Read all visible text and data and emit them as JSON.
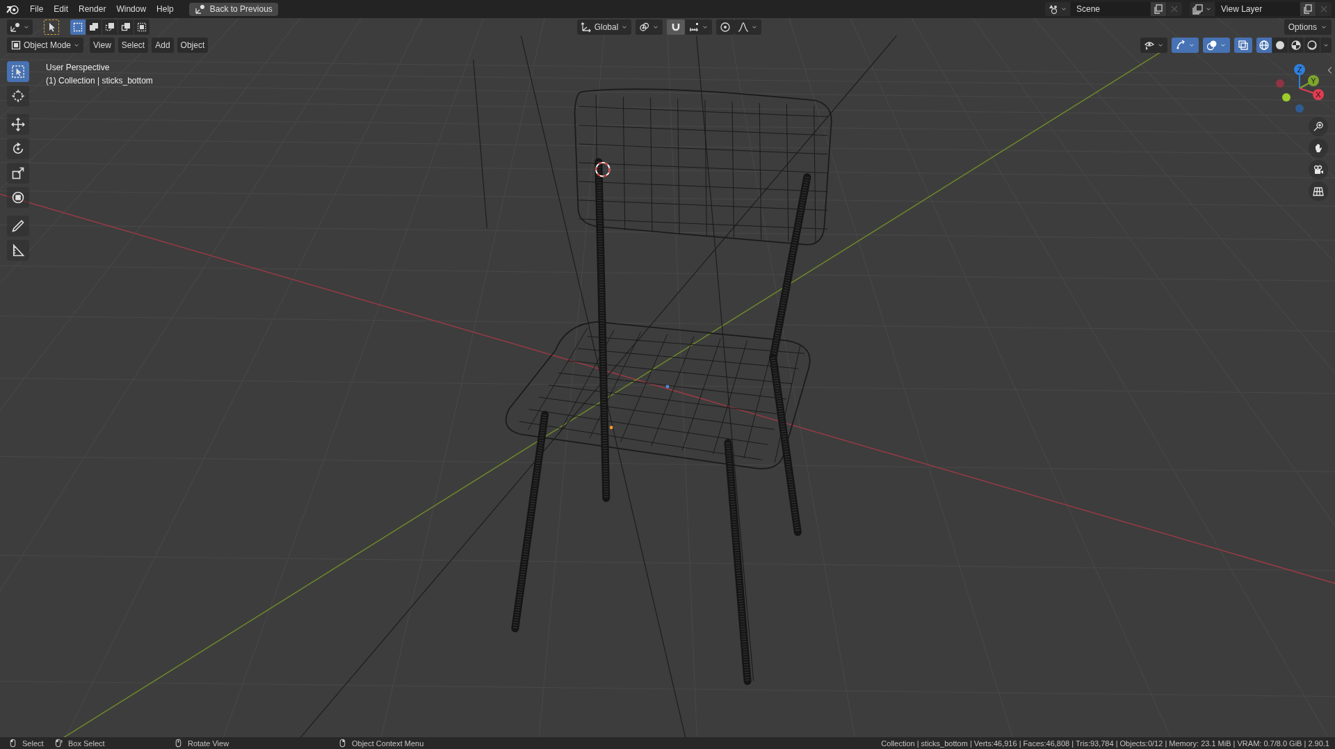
{
  "menu_bar": {
    "menus": [
      "File",
      "Edit",
      "Render",
      "Window",
      "Help"
    ],
    "back_button": "Back to Previous",
    "scene": "Scene",
    "view_layer": "View Layer"
  },
  "tool_header": {
    "select_modes": [
      {
        "selected": true
      },
      {
        "selected": false
      },
      {
        "selected": false
      },
      {
        "selected": false
      },
      {
        "selected": false
      }
    ],
    "orientation": "Global",
    "snap": {
      "on": true
    },
    "proportional": {
      "on": false
    },
    "options": "Options"
  },
  "viewport_header": {
    "mode": "Object Mode",
    "menus": [
      "View",
      "Select",
      "Add",
      "Object"
    ],
    "toggles": [
      {
        "kind": "visibility",
        "on": false
      },
      {
        "kind": "gizmos",
        "on": true
      },
      {
        "kind": "overlays",
        "on": true
      },
      {
        "kind": "xray",
        "on": true
      }
    ],
    "shading": [
      {
        "kind": "wireframe",
        "selected": true
      },
      {
        "kind": "solid",
        "selected": false
      },
      {
        "kind": "material",
        "selected": false
      },
      {
        "kind": "rendered",
        "selected": false
      }
    ]
  },
  "toolbar": {
    "tools": [
      {
        "kind": "select",
        "selected": true
      },
      {
        "kind": "cursor",
        "selected": false
      },
      {
        "kind": "move",
        "selected": false
      },
      {
        "kind": "rotate",
        "selected": false
      },
      {
        "kind": "scale",
        "selected": false
      },
      {
        "kind": "transform",
        "selected": false
      },
      {
        "kind": "annotate",
        "selected": false
      },
      {
        "kind": "measure",
        "selected": false
      }
    ]
  },
  "viewport_info": [
    "User Perspective",
    "(1) Collection | sticks_bottom"
  ],
  "navigation_gizmo": {
    "axes": [
      {
        "label": "Z",
        "color": "#2e7fe0"
      },
      {
        "label": "Y",
        "color": "#7ea52c"
      },
      {
        "label": "X",
        "color": "#e23c50"
      }
    ]
  },
  "status_bar": {
    "hints": [
      {
        "kind": "left",
        "text": "Select"
      },
      {
        "kind": "drag",
        "text": "Box Select"
      },
      {
        "kind": "middle",
        "text": "Rotate View"
      },
      {
        "kind": "right",
        "text": "Object Context Menu"
      }
    ],
    "stats": "Collection | sticks_bottom | Verts:46,916 | Faces:46,808 | Tris:93,784 | Objects:0/12 | Memory: 23.1 MiB | VRAM: 0.7/8.0 GiB | 2.90.1"
  }
}
